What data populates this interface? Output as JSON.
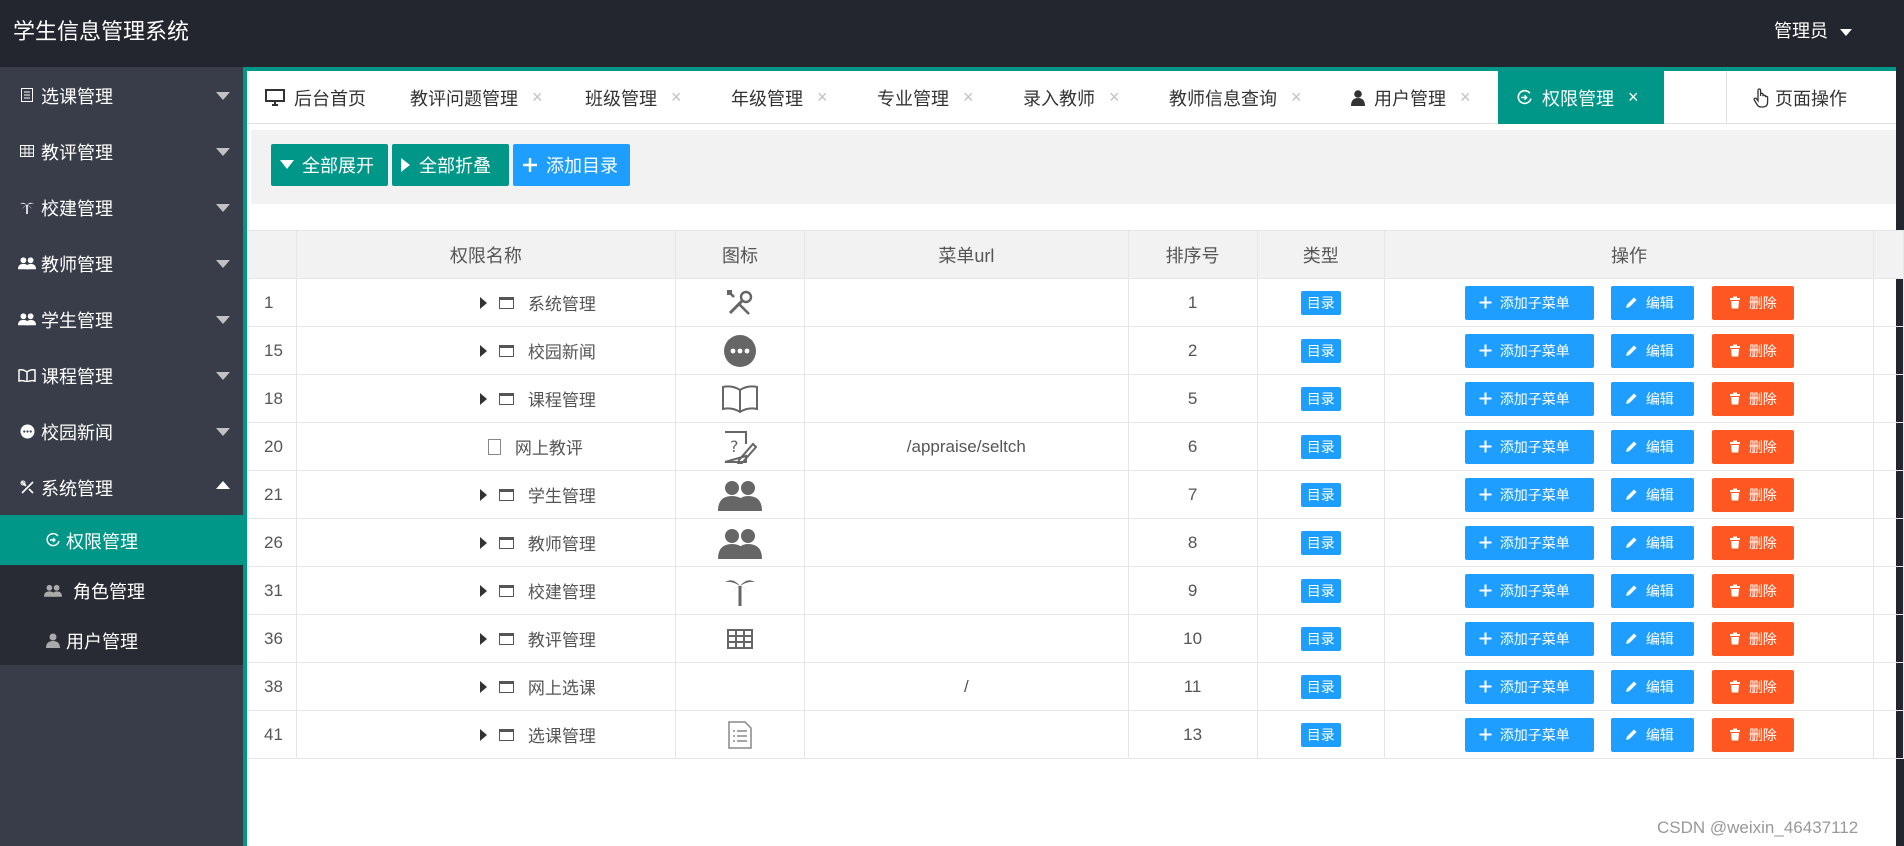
{
  "app": {
    "title": "学生信息管理系统",
    "user": "管理员"
  },
  "sidebar": {
    "items": [
      {
        "label": "选课管理",
        "icon": "list-icon"
      },
      {
        "label": "教评管理",
        "icon": "table-icon"
      },
      {
        "label": "校建管理",
        "icon": "palm-tree-icon"
      },
      {
        "label": "教师管理",
        "icon": "users-icon"
      },
      {
        "label": "学生管理",
        "icon": "users-icon"
      },
      {
        "label": "课程管理",
        "icon": "book-icon"
      },
      {
        "label": "校园新闻",
        "icon": "chat-icon"
      },
      {
        "label": "系统管理",
        "icon": "tools-icon"
      }
    ],
    "sub_items": [
      {
        "label": "权限管理",
        "icon": "permission-icon"
      },
      {
        "label": "角色管理",
        "icon": "users-icon"
      },
      {
        "label": "用户管理",
        "icon": "user-icon"
      }
    ]
  },
  "tabs": [
    {
      "label": "后台首页",
      "icon": "monitor-icon"
    },
    {
      "label": "教评问题管理"
    },
    {
      "label": "班级管理"
    },
    {
      "label": "年级管理"
    },
    {
      "label": "专业管理"
    },
    {
      "label": "录入教师"
    },
    {
      "label": "教师信息查询"
    },
    {
      "label": "用户管理",
      "icon": "user-icon"
    },
    {
      "label": "权限管理",
      "icon": "permission-icon"
    }
  ],
  "tab_close": "×",
  "page_op": "页面操作",
  "toolbar": {
    "expand_all": "全部展开",
    "collapse_all": "全部折叠",
    "add_dir": "添加目录"
  },
  "table": {
    "headers": [
      "权限名称",
      "图标",
      "菜单url",
      "排序号",
      "类型",
      "操作"
    ],
    "rows": [
      {
        "id": "1",
        "name": "系统管理",
        "folder": true,
        "icon": "tools-icon",
        "url": "",
        "sort": "1",
        "type": "目录"
      },
      {
        "id": "15",
        "name": "校园新闻",
        "folder": true,
        "icon": "chat-icon",
        "url": "",
        "sort": "2",
        "type": "目录"
      },
      {
        "id": "18",
        "name": "课程管理",
        "folder": true,
        "icon": "book-icon",
        "url": "",
        "sort": "5",
        "type": "目录"
      },
      {
        "id": "20",
        "name": "网上教评",
        "folder": false,
        "icon": "edit-question-icon",
        "url": "/appraise/seltch",
        "sort": "6",
        "type": "目录"
      },
      {
        "id": "21",
        "name": "学生管理",
        "folder": true,
        "icon": "users-icon",
        "url": "",
        "sort": "7",
        "type": "目录"
      },
      {
        "id": "26",
        "name": "教师管理",
        "folder": true,
        "icon": "users-icon",
        "url": "",
        "sort": "8",
        "type": "目录"
      },
      {
        "id": "31",
        "name": "校建管理",
        "folder": true,
        "icon": "palm-tree-icon",
        "url": "",
        "sort": "9",
        "type": "目录"
      },
      {
        "id": "36",
        "name": "教评管理",
        "folder": true,
        "icon": "table-icon",
        "url": "",
        "sort": "10",
        "type": "目录"
      },
      {
        "id": "38",
        "name": "网上选课",
        "folder": true,
        "icon": "",
        "url": "/",
        "sort": "11",
        "type": "目录"
      },
      {
        "id": "41",
        "name": "选课管理",
        "folder": true,
        "icon": "list-icon",
        "url": "",
        "sort": "13",
        "type": "目录"
      }
    ],
    "ops": {
      "add_child": "添加子菜单",
      "edit": "编辑",
      "delete": "删除"
    }
  },
  "watermark": "CSDN @weixin_46437112",
  "colors": {
    "header_bg": "#23262e",
    "sidebar_bg": "#393d49",
    "accent": "#009688",
    "blue": "#1e9fff",
    "danger": "#ff5722"
  }
}
